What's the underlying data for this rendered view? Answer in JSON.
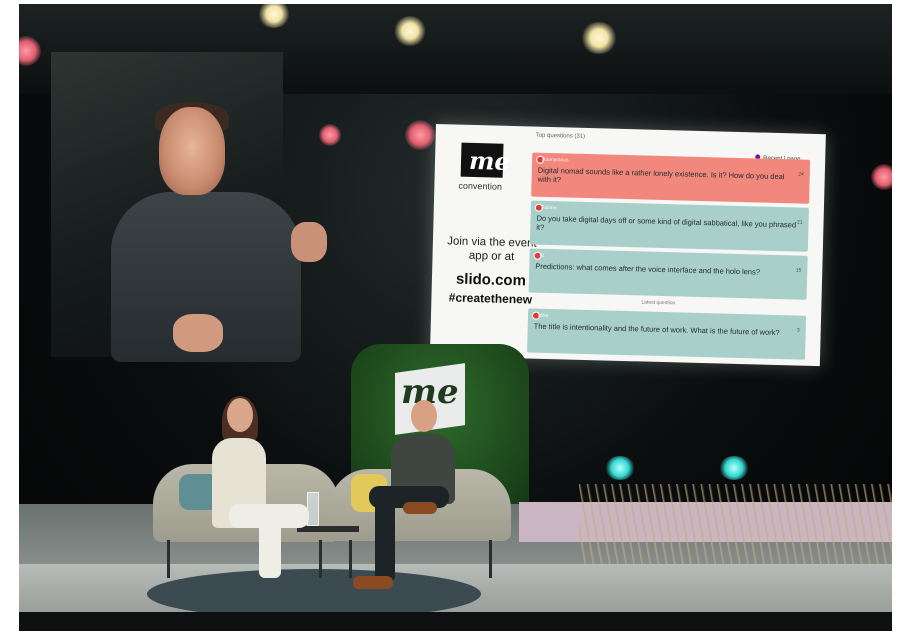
{
  "slide": {
    "top_label": "Top questions (31)",
    "sort_label": "Recent | page",
    "logo_text": "me",
    "logo_sub": "convention",
    "join_text": "Join via the event app or at",
    "url": "slido.com",
    "hashtag": "#createthenew",
    "latest_label": "Latest question",
    "questions": [
      {
        "author": "Anonymous",
        "text": "Digital nomad sounds like a rather lonely existence. Is it? How do you deal with it?",
        "votes": "24"
      },
      {
        "author": "Sabine",
        "text": "Do you take digital days off or some kind of digital sabbatical, like you phrased it?",
        "votes": "21"
      },
      {
        "author": "Kt",
        "text": "Predictions: what comes after the voice interface and the holo lens?",
        "votes": "15"
      },
      {
        "author": "Mike",
        "text": "The title is intentionality and the future of work. What is the future of work?",
        "votes": "3"
      }
    ]
  },
  "wall": {
    "logo_text": "me"
  },
  "colors": {
    "question_highlight": "#f2877d",
    "question_normal": "#a8cfc9",
    "accent_purple": "#6a1b9a"
  }
}
